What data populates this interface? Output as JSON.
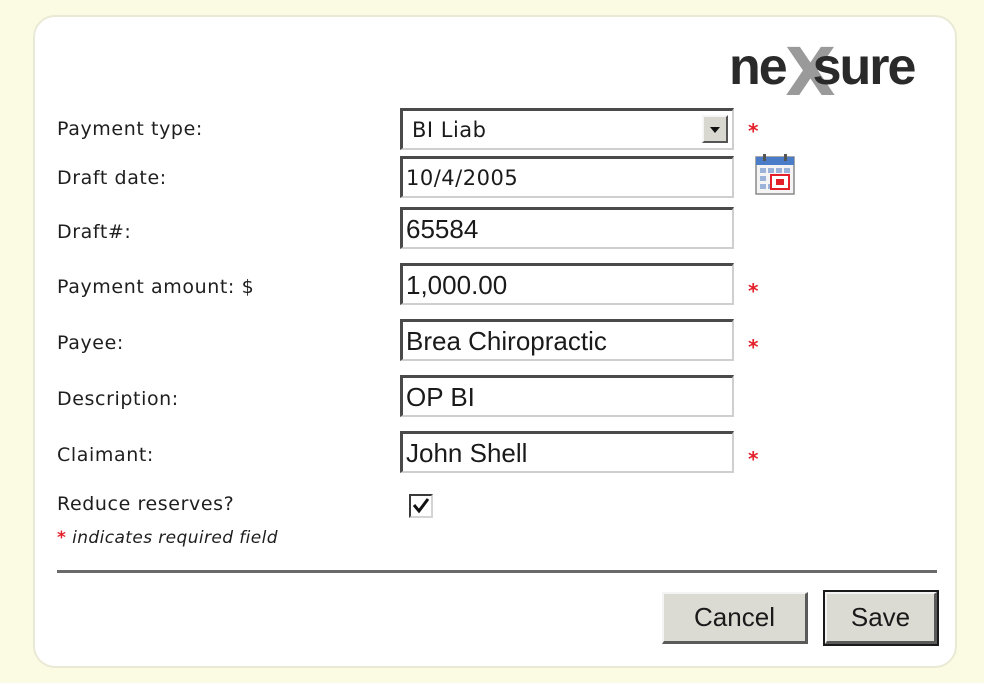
{
  "brand": {
    "logo_text": "nexsure",
    "logo_prefix": "ne",
    "logo_suffix": "sure",
    "logo_x": "X"
  },
  "form": {
    "payment_type": {
      "label": "Payment type:",
      "value": "BI Liab",
      "required": true
    },
    "draft_date": {
      "label": "Draft date:",
      "value": "10/4/2005",
      "required": false
    },
    "draft_number": {
      "label": "Draft#:",
      "value": "65584",
      "required": false
    },
    "payment_amount": {
      "label": "Payment amount: $",
      "value": "1,000.00",
      "required": true
    },
    "payee": {
      "label": "Payee:",
      "value": "Brea Chiropractic",
      "required": true
    },
    "description": {
      "label": "Description:",
      "value": "OP BI",
      "required": false
    },
    "claimant": {
      "label": "Claimant:",
      "value": "John Shell",
      "required": true
    },
    "reduce_reserves": {
      "label": "Reduce reserves?",
      "checked": true
    },
    "required_marker": "*",
    "required_note": "indicates required field"
  },
  "actions": {
    "cancel_label": "Cancel",
    "save_label": "Save"
  },
  "colors": {
    "required": "#e3202a",
    "page_background": "#fbfbe4",
    "button_face": "#dcdbd3"
  },
  "icons": {
    "calendar": "calendar-icon",
    "dropdown": "chevron-down-icon",
    "check": "checkmark-icon"
  }
}
